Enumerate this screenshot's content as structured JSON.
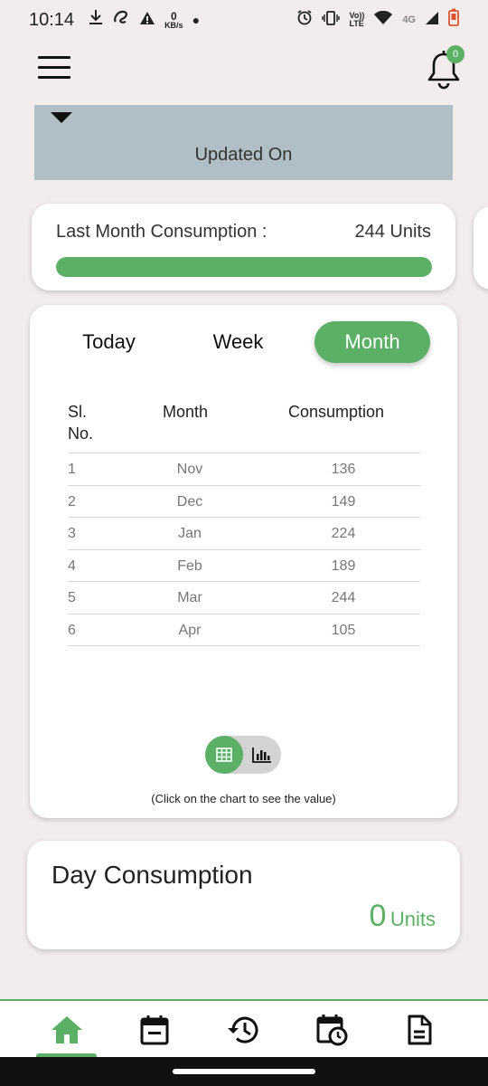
{
  "status_bar": {
    "time": "10:14",
    "net_speed_value": "0",
    "net_speed_unit": "KB/s",
    "volte_label_top": "Vo))",
    "volte_label_bottom": "LTE",
    "network_type": "4G"
  },
  "header": {
    "notification_count": "0"
  },
  "banner": {
    "updated_label": "Updated On"
  },
  "last_month": {
    "label": "Last Month Consumption :",
    "value": "244 Units",
    "progress_fraction": 1.0
  },
  "tabs": [
    {
      "label": "Today",
      "active": false
    },
    {
      "label": "Week",
      "active": false
    },
    {
      "label": "Month",
      "active": true
    }
  ],
  "table": {
    "headers": {
      "sl": "Sl. No.",
      "month": "Month",
      "consumption": "Consumption"
    },
    "rows": [
      {
        "sl": "1",
        "month": "Nov",
        "consumption": "136"
      },
      {
        "sl": "2",
        "month": "Dec",
        "consumption": "149"
      },
      {
        "sl": "3",
        "month": "Jan",
        "consumption": "224"
      },
      {
        "sl": "4",
        "month": "Feb",
        "consumption": "189"
      },
      {
        "sl": "5",
        "month": "Mar",
        "consumption": "244"
      },
      {
        "sl": "6",
        "month": "Apr",
        "consumption": "105"
      }
    ]
  },
  "chart_hint": "(Click on the chart to see the value)",
  "day_consumption": {
    "title": "Day Consumption",
    "value": "0",
    "unit": "Units"
  },
  "colors": {
    "accent": "#5cb065",
    "banner": "#b0bec6",
    "background": "#f2ecec"
  },
  "icons": {
    "nav": [
      "home-icon",
      "calendar-icon",
      "history-icon",
      "schedule-icon",
      "document-icon"
    ]
  }
}
